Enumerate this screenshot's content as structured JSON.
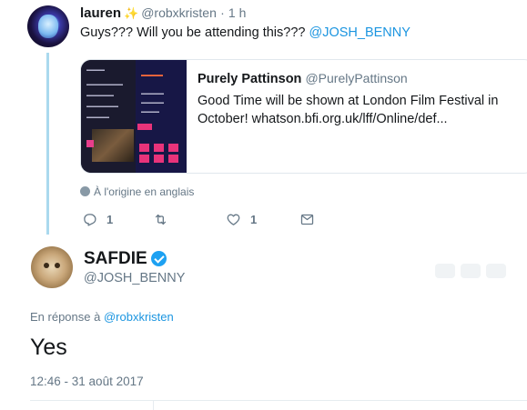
{
  "tweet1": {
    "name": "lauren",
    "sparkle": "✨",
    "handle": "@robxkristen",
    "dot": "·",
    "time": "1 h",
    "text_before": "Guys??? Will you be attending this??? ",
    "mention": "@JOSH_BENNY",
    "translation_note": "À l'origine en anglais",
    "actions": {
      "reply_count": "1",
      "retweet_count": "",
      "like_count": "1"
    }
  },
  "quoted": {
    "name": "Purely Pattinson",
    "handle": "@PurelyPattinson",
    "text": "Good Time will be shown at London Film Festival in October! whatson.bfi.org.uk/lff/Online/def..."
  },
  "tweet2": {
    "name": "SAFDIE",
    "handle": "@JOSH_BENNY",
    "reply_prefix": "En réponse à ",
    "reply_mention": "@robxkristen",
    "text": "Yes",
    "timestamp": "12:46 - 31 août 2017"
  },
  "colors": {
    "link": "#1b95e0",
    "muted": "#657786",
    "thread_line": "#aad9ee",
    "verified": "#1da1f2"
  },
  "icons": [
    "reply-icon",
    "retweet-icon",
    "like-icon",
    "message-icon",
    "verified-icon",
    "globe-icon",
    "sparkle-icon"
  ]
}
